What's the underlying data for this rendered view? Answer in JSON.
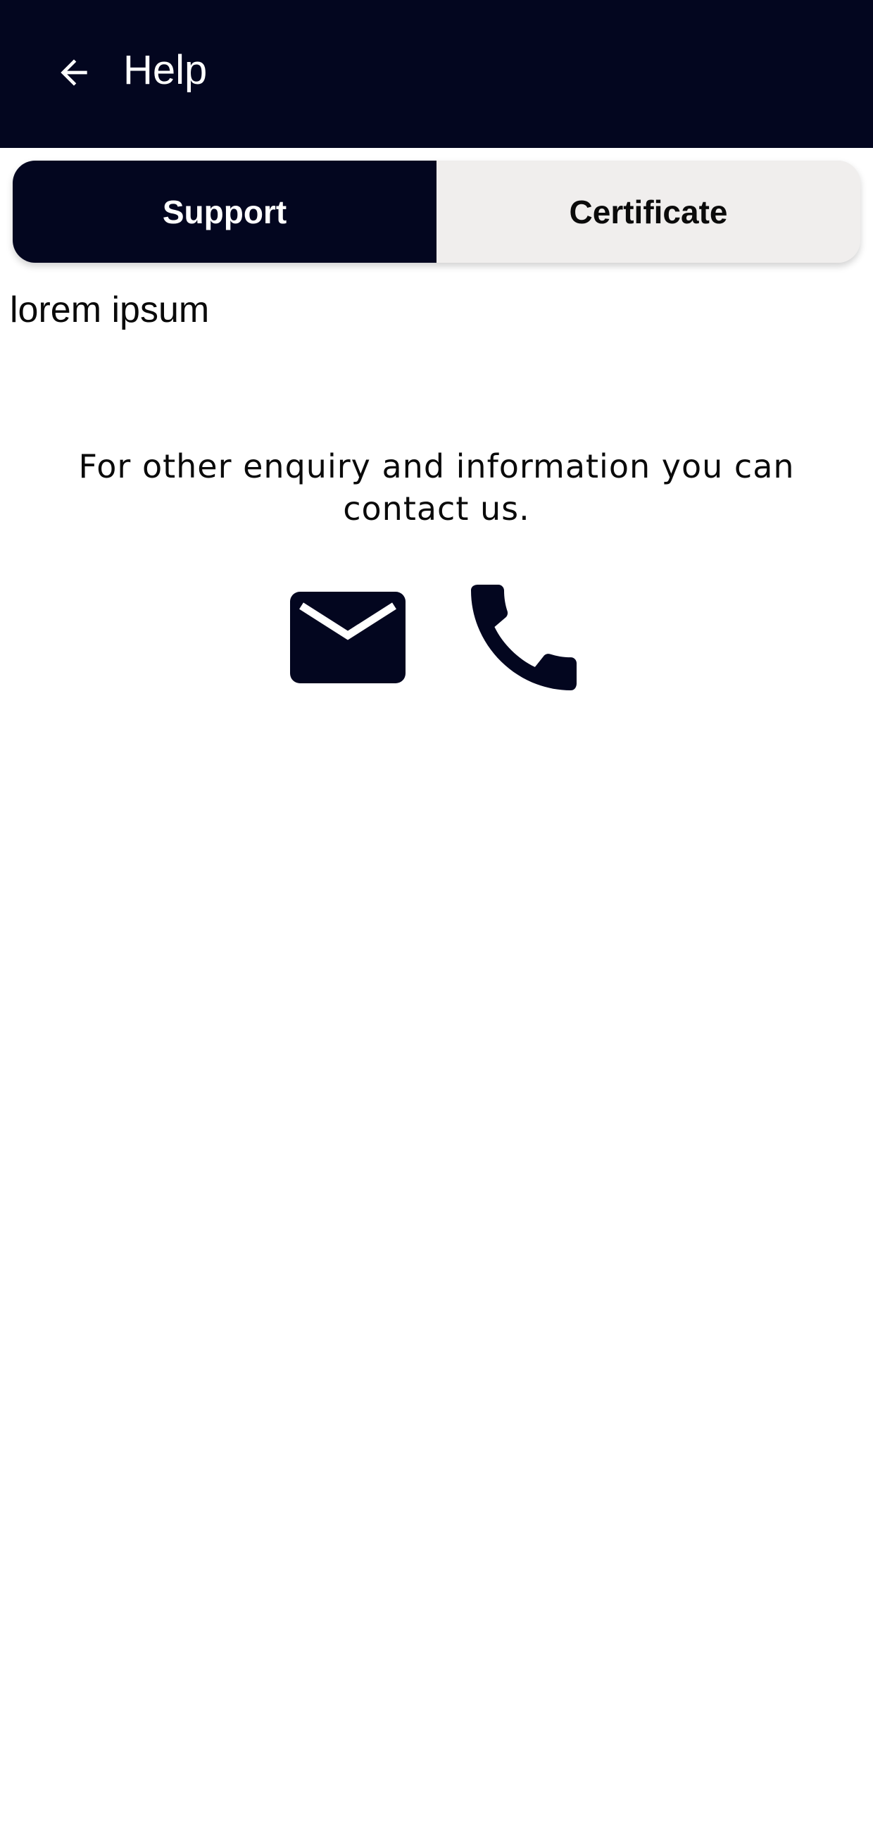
{
  "header": {
    "title": "Help",
    "back_icon": "arrow-left-icon"
  },
  "tabs": [
    {
      "label": "Support",
      "active": true
    },
    {
      "label": "Certificate",
      "active": false
    }
  ],
  "support": {
    "text": "lorem ipsum"
  },
  "contact": {
    "message": "For other enquiry and information you can contact us.",
    "email_icon": "mail-icon",
    "phone_icon": "phone-icon"
  },
  "colors": {
    "primary": "#03061f",
    "tab_inactive_bg": "#f0eeed",
    "background": "#ffffff"
  }
}
